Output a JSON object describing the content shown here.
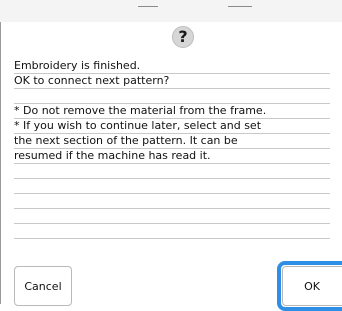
{
  "dialog": {
    "icon": "question-icon",
    "icon_glyph": "?",
    "message_lines": [
      "Embroidery is finished.",
      "OK to connect next pattern?",
      "",
      "* Do not remove the material from the frame.",
      "* If you wish to continue later, select and set",
      "the next section of the pattern. It can be",
      "resumed if the machine has read it.",
      "",
      "",
      "",
      "",
      ""
    ]
  },
  "buttons": {
    "cancel_label": "Cancel",
    "ok_label": "OK"
  },
  "colors": {
    "focus_ring": "#2f8ee6",
    "icon_bg": "#d6d6d6"
  }
}
